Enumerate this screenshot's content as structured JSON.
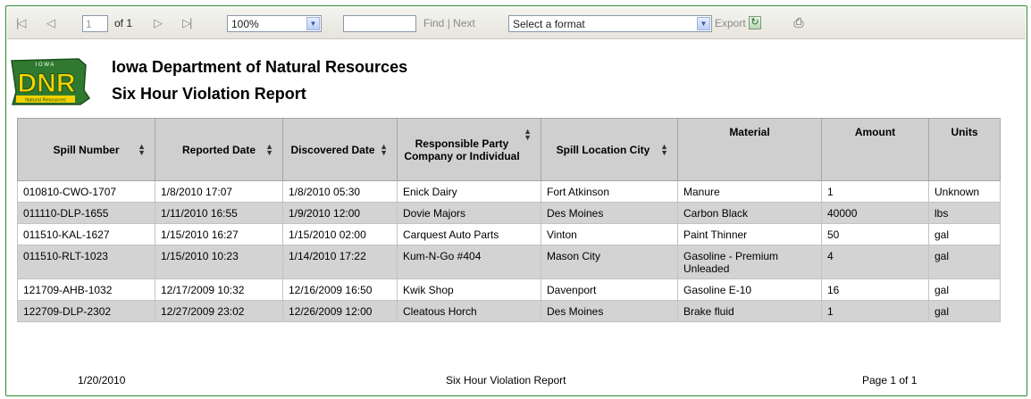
{
  "toolbar": {
    "page_current": "1",
    "page_of": "of 1",
    "zoom": "100%",
    "find_value": "",
    "find_label": "Find",
    "separator": "|",
    "next_label": "Next",
    "format_select": "Select a format",
    "export_label": "Export"
  },
  "header": {
    "logo_top": "I O W A",
    "logo_main": "DNR",
    "logo_bottom": "Natural Resources",
    "org_title": "Iowa Department of Natural Resources",
    "report_title": "Six Hour Violation Report"
  },
  "table": {
    "columns": [
      "Spill Number",
      "Reported Date",
      "Discovered Date",
      "Responsible Party Company or Individual",
      "Spill Location City",
      "Material",
      "Amount",
      "Units"
    ],
    "rows": [
      [
        "010810-CWO-1707",
        "1/8/2010 17:07",
        "1/8/2010 05:30",
        "Enick Dairy",
        "Fort Atkinson",
        "Manure",
        "1",
        "Unknown"
      ],
      [
        "011110-DLP-1655",
        "1/11/2010 16:55",
        "1/9/2010 12:00",
        "Dovie Majors",
        "Des Moines",
        "Carbon Black",
        "40000",
        "lbs"
      ],
      [
        "011510-KAL-1627",
        "1/15/2010 16:27",
        "1/15/2010 02:00",
        "Carquest Auto Parts",
        "Vinton",
        "Paint Thinner",
        "50",
        "gal"
      ],
      [
        "011510-RLT-1023",
        "1/15/2010 10:23",
        "1/14/2010 17:22",
        "Kum-N-Go #404",
        "Mason City",
        "Gasoline - Premium Unleaded",
        "4",
        "gal"
      ],
      [
        "121709-AHB-1032",
        "12/17/2009 10:32",
        "12/16/2009 16:50",
        "Kwik Shop",
        "Davenport",
        "Gasoline E-10",
        "16",
        "gal"
      ],
      [
        "122709-DLP-2302",
        "12/27/2009 23:02",
        "12/26/2009 12:00",
        "Cleatous Horch",
        "Des Moines",
        "Brake fluid",
        "1",
        "gal"
      ]
    ]
  },
  "footer": {
    "date": "1/20/2010",
    "title": "Six Hour Violation Report",
    "page": "Page 1 of 1"
  },
  "colors": {
    "frame_border": "#2e8b2e",
    "header_bg": "#cfcfcf",
    "alt_row_bg": "#d3d3d3",
    "logo_yellow": "#f2d200",
    "logo_green": "#2f7a2f"
  },
  "icons": [
    "first-page-icon",
    "prev-page-icon",
    "next-page-icon",
    "last-page-icon",
    "dropdown-arrow-icon",
    "refresh-icon",
    "print-icon",
    "sort-icon"
  ]
}
